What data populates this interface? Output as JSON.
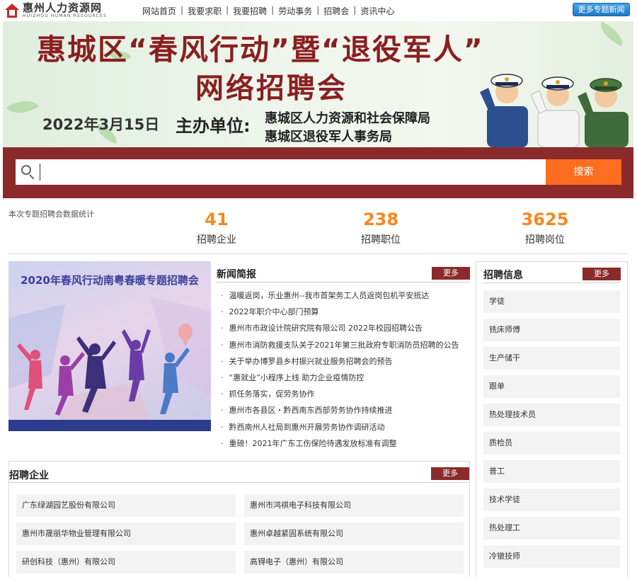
{
  "header": {
    "logo_cn": "惠州人力资源网",
    "logo_en": "HUIZHOU HUMAN RESOURCES",
    "nav": [
      "网站首页",
      "我要求职",
      "我要招聘",
      "劳动事务",
      "招聘会",
      "资讯中心"
    ],
    "more_news_label": "更多专题新闻"
  },
  "banner": {
    "title_line1": "惠城区“春风行动”暨“退役军人”",
    "title_line2": "网络招聘会",
    "date": "2022年3月15日",
    "organizer_label": "主办单位:",
    "organizer_1": "惠城区人力资源和社会保障局",
    "organizer_2": "惠城区退役军人事务局"
  },
  "search": {
    "placeholder": "",
    "button_label": "搜索"
  },
  "stats": {
    "caption": "本次专题招聘会数据统计",
    "items": [
      {
        "value": "41",
        "label": "招聘企业"
      },
      {
        "value": "238",
        "label": "招聘职位"
      },
      {
        "value": "3625",
        "label": "招聘岗位"
      }
    ]
  },
  "promo": {
    "title": "2020年春风行动南粤春暖专题招聘会"
  },
  "news": {
    "title": "新闻简报",
    "more_label": "更多",
    "items": [
      "温暖返岗，乐业惠州--我市首架务工人员返岗包机平安抵达",
      "2022年职介中心部门预算",
      "惠州市市政设计院研究院有限公司 2022年校园招聘公告",
      "惠州市消防救援支队关于2021年第三批政府专职消防员招聘的公告",
      "关于举办博罗县乡村振兴就业服务招聘会的预告",
      "“惠就业”小程序上线 助力企业疫情防控",
      "抓任务落实，促劳务协作",
      "惠州市各县区・黔西南东西部劳务协作持续推进",
      "黔西南州人社局到惠州开展劳务协作调研活动",
      "重磅！2021年广东工伤保险待遇发放标准有调整"
    ]
  },
  "jobs": {
    "title": "招聘信息",
    "more_label": "更多",
    "items": [
      "学徒",
      "铣床师傅",
      "生产储干",
      "跟单",
      "热处理技术员",
      "质检员",
      "普工",
      "技术学徒",
      "热处理工",
      "冷镦技师"
    ]
  },
  "companies": {
    "title": "招聘企业",
    "more_label": "更多",
    "items": [
      "广东绿湖园艺股份有限公司",
      "惠州市鸿祺电子科技有限公司",
      "惠州市晟丽华物业管理有限公司",
      "惠州卓越紧固系统有限公司",
      "研创科技（惠州）有限公司",
      "高锝电子（惠州）有限公司"
    ]
  },
  "colors": {
    "brand_dark_red": "#8a2a2b",
    "accent_orange": "#ff6d1f",
    "stat_orange": "#f5891f",
    "more_news_blue": "#1f78c7"
  }
}
